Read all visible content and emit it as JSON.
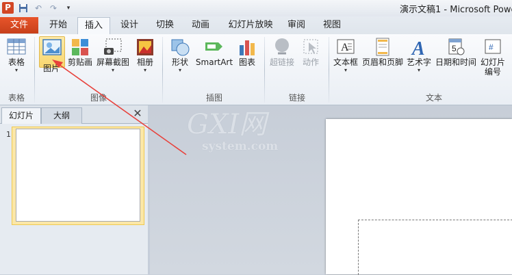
{
  "app": {
    "icon_letter": "P",
    "title": "演示文稿1 - Microsoft Powe"
  },
  "quick_access": {
    "save": "save-icon",
    "undo": "undo-icon",
    "redo": "redo-icon"
  },
  "tabs": {
    "file": "文件",
    "items": [
      "开始",
      "插入",
      "设计",
      "切换",
      "动画",
      "幻灯片放映",
      "审阅",
      "视图"
    ],
    "active": "插入"
  },
  "ribbon": {
    "groups": {
      "table": "表格",
      "image": "图像",
      "illustration": "插图",
      "link": "链接",
      "text": "文本"
    },
    "buttons": {
      "table": "表格",
      "picture": "图片",
      "clipart": "剪贴画",
      "screenshot": "屏幕截图",
      "album": "相册",
      "shape": "形状",
      "smartart": "SmartArt",
      "chart": "图表",
      "hyperlink": "超链接",
      "action": "动作",
      "textbox": "文本框",
      "header_footer": "页眉和页脚",
      "wordart": "艺术字",
      "datetime": "日期和时间",
      "slide_number_1": "幻灯片",
      "slide_number_2": "编号"
    }
  },
  "left_panel": {
    "tab_slides": "幻灯片",
    "tab_outline": "大纲",
    "close": "✕",
    "slide_number": "1"
  },
  "watermark": {
    "big": "GXI网",
    "small": "system.com"
  },
  "colors": {
    "file_tab": "#d24625",
    "highlight": "#f8d66e",
    "arrow": "#e8413b"
  }
}
